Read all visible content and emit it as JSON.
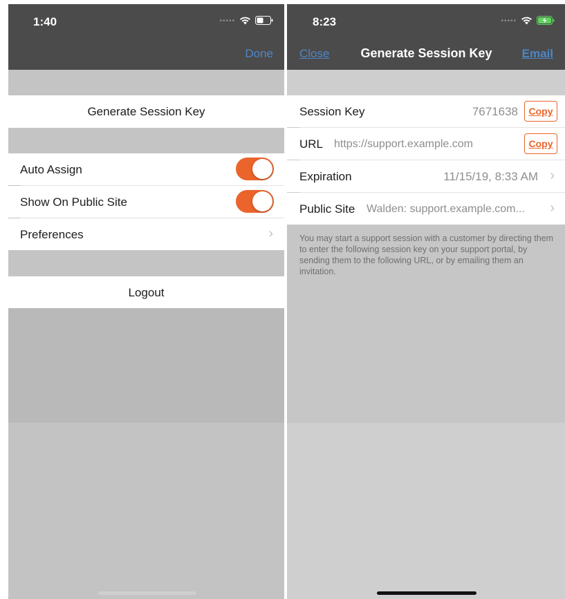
{
  "left": {
    "status_time": "1:40",
    "nav": {
      "done_label": "Done"
    },
    "generate_session_key_label": "Generate Session Key",
    "settings": [
      {
        "label": "Auto Assign",
        "toggle": true
      },
      {
        "label": "Show On Public Site",
        "toggle": true
      },
      {
        "label": "Preferences",
        "chevron": true
      }
    ],
    "logout_label": "Logout"
  },
  "right": {
    "status_time": "8:23",
    "nav": {
      "close_label": "Close",
      "title": "Generate Session Key",
      "email_label": "Email"
    },
    "rows": {
      "session_key": {
        "label": "Session Key",
        "value": "7671638",
        "copy": "Copy"
      },
      "url": {
        "label": "URL",
        "value": "https://support.example.com",
        "copy": "Copy"
      },
      "expiration": {
        "label": "Expiration",
        "value": "11/15/19, 8:33 AM"
      },
      "public_site": {
        "label": "Public Site",
        "value": "Walden: support.example.com..."
      }
    },
    "footer_note": "You may start a support session with a customer by directing them to enter the following session key on your support portal, by sending them to the following URL, or by emailing them an invitation."
  },
  "colors": {
    "accent_orange": "#ea642b",
    "nav_link_blue": "#4f86c6",
    "nav_background": "#4b4b4b"
  },
  "icons": [
    "wifi-icon",
    "battery-icon",
    "battery-charging-icon",
    "chevron-right-icon",
    "signal-dots-icon"
  ]
}
